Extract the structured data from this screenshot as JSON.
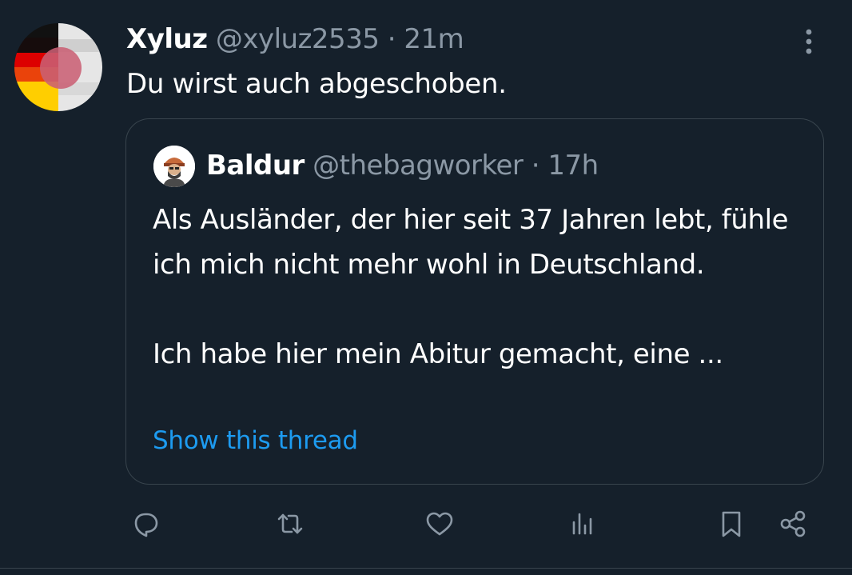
{
  "tweet": {
    "author_name": "Xyluz",
    "author_handle": "@xyluz2535",
    "separator": "·",
    "time": "21m",
    "text": "Du wirst auch abgeschoben."
  },
  "quoted_tweet": {
    "author_name": "Baldur",
    "author_handle": "@thebagworker",
    "separator": "·",
    "time": "17h",
    "paragraph_1": "Als Ausländer, der hier seit 37 Jahren lebt, fühle ich mich nicht mehr wohl in Deutschland.",
    "paragraph_2": "Ich habe hier mein Abitur gemacht, eine ...",
    "show_thread": "Show this thread"
  },
  "actions": {
    "reply_icon": "speech-bubble-icon",
    "retweet_icon": "retweet-arrows-icon",
    "like_icon": "heart-icon",
    "views_icon": "bar-chart-icon",
    "bookmark_icon": "bookmark-icon",
    "share_icon": "share-icon"
  },
  "more_icon": "more-vertical-icon",
  "colors": {
    "background": "#15202b",
    "text_primary": "#ffffff",
    "text_secondary": "#8b98a5",
    "link": "#1d9bf0",
    "border": "#38444d"
  }
}
